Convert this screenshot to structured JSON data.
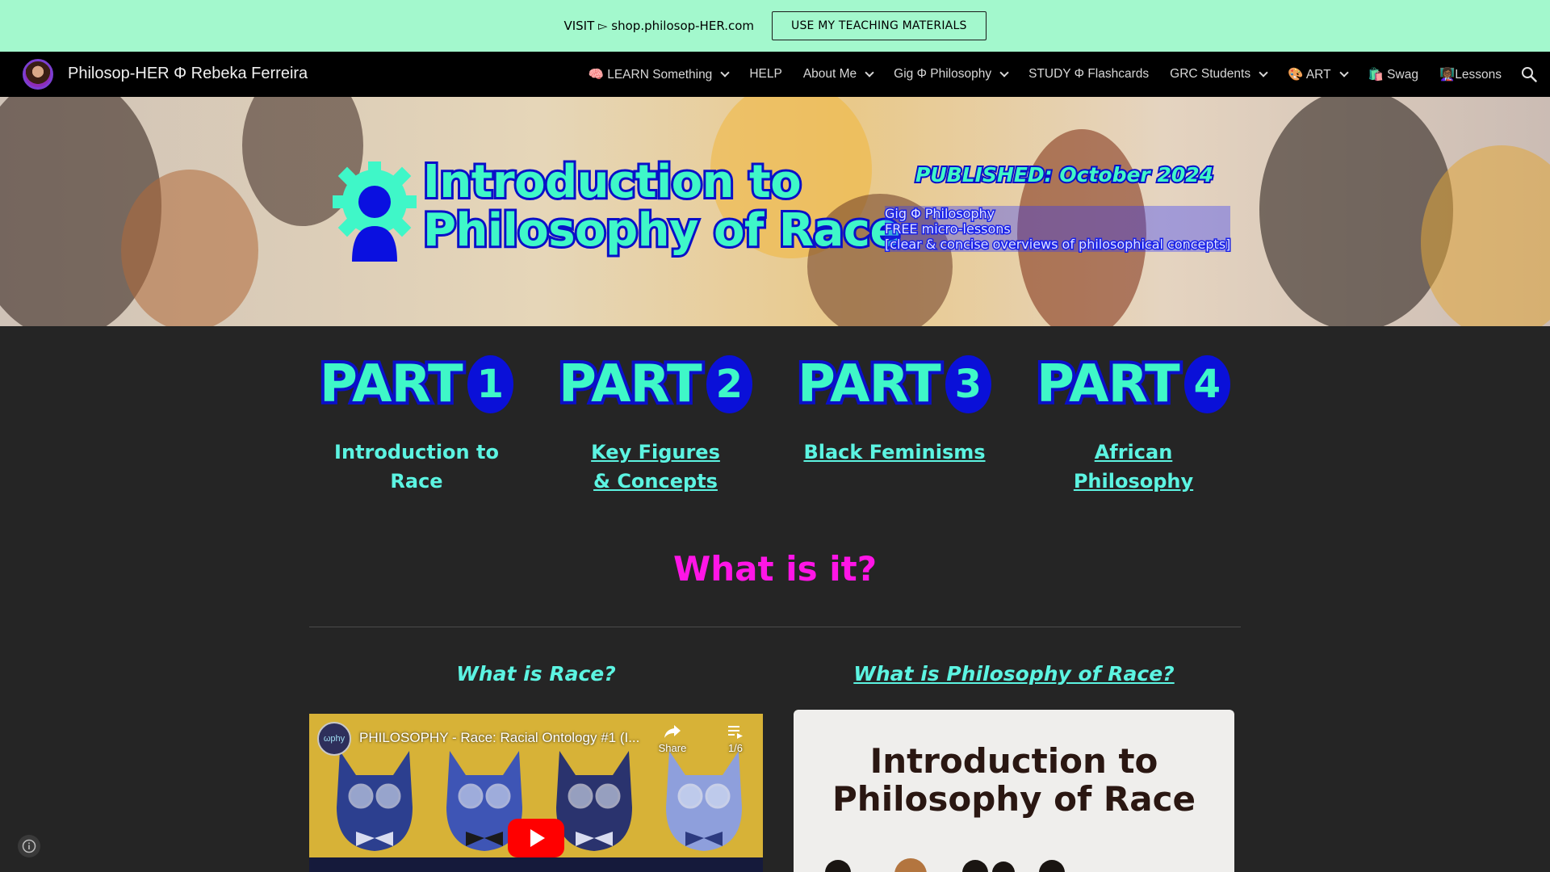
{
  "banner": {
    "text": "VISIT ▻ shop.philosop-HER.com",
    "button_label": "USE MY TEACHING MATERIALS"
  },
  "nav": {
    "site_title": "Philosop-HER Φ Rebeka Ferreira",
    "items": [
      {
        "label": "🧠 LEARN Something",
        "dropdown": true
      },
      {
        "label": "HELP",
        "dropdown": false
      },
      {
        "label": "About Me",
        "dropdown": true
      },
      {
        "label": "Gig Φ Philosophy",
        "dropdown": true
      },
      {
        "label": "STUDY Φ Flashcards",
        "dropdown": false
      },
      {
        "label": "GRC Students",
        "dropdown": true
      },
      {
        "label": "🎨 ART",
        "dropdown": true
      },
      {
        "label": "🛍️ Swag",
        "dropdown": false
      },
      {
        "label": "👩🏾‍🏫Lessons",
        "dropdown": false
      }
    ],
    "search_icon": "search-icon"
  },
  "hero": {
    "title_line1": "Introduction to",
    "title_line2": "Philosophy of Race",
    "published": "PUBLISHED: October 2024",
    "subtitle_lines": [
      "Gig Φ Philosophy",
      "FREE micro-lessons",
      "[clear & concise overviews of philosophical concepts]"
    ],
    "logo_icon": "gear-person-icon"
  },
  "parts": [
    {
      "word": "PART",
      "number": "1",
      "label": "Introduction to Race",
      "is_link": false
    },
    {
      "word": "PART",
      "number": "2",
      "label": "Key Figures & Concepts",
      "is_link": true
    },
    {
      "word": "PART",
      "number": "3",
      "label": "Black Feminisms",
      "is_link": true
    },
    {
      "word": "PART",
      "number": "4",
      "label": "African Philosophy",
      "is_link": true
    }
  ],
  "section": {
    "heading": "What is it?",
    "left_heading": "What is Race?",
    "right_heading": "What is Philosophy of Race?"
  },
  "video": {
    "channel": "ωphy",
    "title": "PHILOSOPHY - Race: Racial Ontology #1 (I...",
    "share_label": "Share",
    "playlist_count": "1/6"
  },
  "slide": {
    "title_line1": "Introduction to",
    "title_line2": "Philosophy of Race"
  },
  "colors": {
    "banner_bg": "#a3f8cd",
    "accent_mint": "#3ff7c8",
    "accent_blue": "#0a10c8",
    "heading_magenta": "#ff15e6",
    "link_cyan": "#5cf4e2",
    "page_bg": "#252525"
  }
}
